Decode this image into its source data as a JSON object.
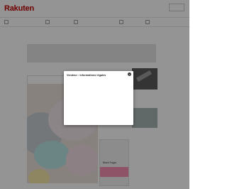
{
  "header": {
    "logo": "Rakuten",
    "tagline": "",
    "account_label": ""
  },
  "nav": {
    "items": [
      "",
      "",
      "",
      "",
      "",
      "",
      ""
    ]
  },
  "side": {
    "text1": "",
    "text2": ""
  },
  "ad": {
    "line1": "",
    "line2": "Black Sugar",
    "label": ""
  },
  "modal": {
    "title": "Vendeur : informations légales",
    "lines": [
      "",
      "",
      "",
      "",
      "",
      "",
      "",
      "",
      "",
      ""
    ]
  },
  "colors": {
    "brand": "#bf0000",
    "overlay": "rgba(0,0,0,0.42)"
  }
}
